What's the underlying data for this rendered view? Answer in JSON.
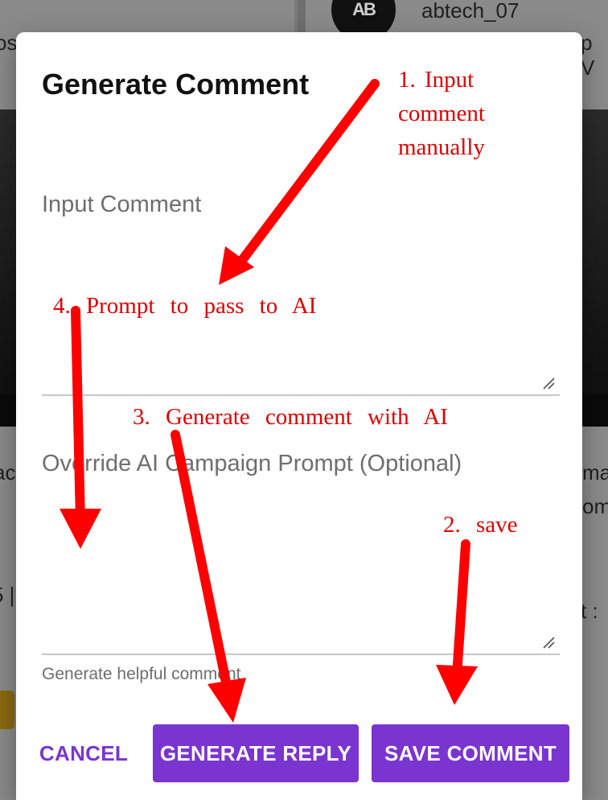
{
  "background": {
    "avatar_initials": "AB",
    "username": "abtech_07",
    "fragments": {
      "left_top": "os",
      "right_top": "p V",
      "left_mid": "ac",
      "right_mid_1": "ma",
      "right_mid_2": "om",
      "left_lower": "5 |",
      "right_lower": "t :"
    }
  },
  "modal": {
    "title": "Generate Comment",
    "input_comment": {
      "label": "Input Comment",
      "value": ""
    },
    "override_prompt": {
      "label": "Override AI Campaign Prompt (Optional)",
      "value": "",
      "helper": "Generate helpful comment"
    },
    "actions": {
      "cancel": "CANCEL",
      "generate": "GENERATE REPLY",
      "save": "SAVE COMMENT"
    }
  },
  "annotations": {
    "step1": "1.  Input comment manually",
    "step2": "2.  save",
    "step3": "3.  Generate  comment  with  AI",
    "step4": "4.  Prompt  to  pass  to  AI",
    "color": "#e00000"
  },
  "colors": {
    "accent": "#7a34d0",
    "overlay": "#6f6f6f"
  }
}
